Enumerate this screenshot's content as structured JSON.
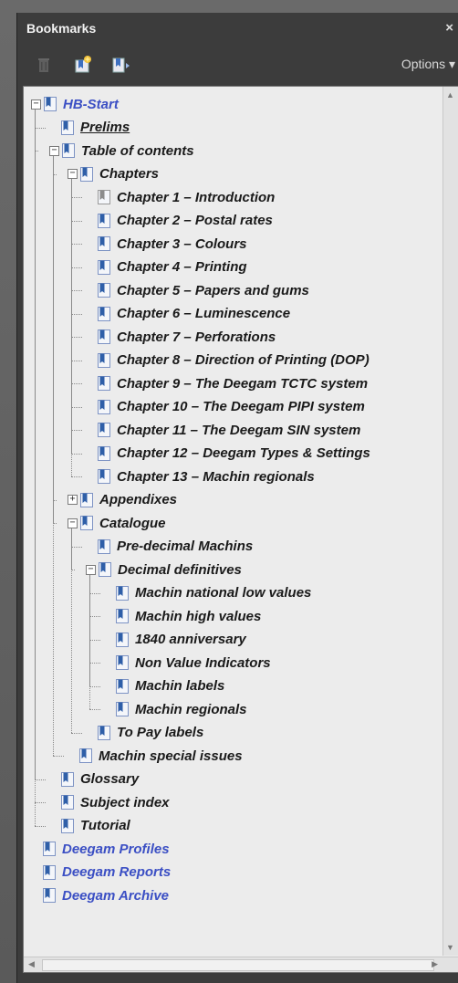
{
  "panel": {
    "title": "Bookmarks",
    "close_glyph": "×",
    "options_label": "Options",
    "options_arrow": "▾"
  },
  "toolbar": {
    "icons": [
      "trash-icon",
      "new-bookmark-icon",
      "expand-bookmark-icon"
    ]
  },
  "colors": {
    "link": "#3b4fc4",
    "text": "#1a1a1a",
    "icon_blue": "#2f5fa8"
  },
  "tree": [
    {
      "label": "HB-Start",
      "level": 0,
      "toggle": "minus",
      "link": true
    },
    {
      "label": "Prelims",
      "level": 1,
      "toggle": "none",
      "underline": true
    },
    {
      "label": "Table of contents",
      "level": 1,
      "toggle": "minus"
    },
    {
      "label": "Chapters",
      "level": 2,
      "toggle": "minus"
    },
    {
      "label": "Chapter 1 – Introduction",
      "level": 3,
      "toggle": "none",
      "grey_icon": true
    },
    {
      "label": "Chapter 2 – Postal rates",
      "level": 3,
      "toggle": "none"
    },
    {
      "label": "Chapter 3 – Colours",
      "level": 3,
      "toggle": "none"
    },
    {
      "label": "Chapter 4  – Printing",
      "level": 3,
      "toggle": "none"
    },
    {
      "label": "Chapter 5 – Papers and gums",
      "level": 3,
      "toggle": "none"
    },
    {
      "label": "Chapter 6 – Luminescence",
      "level": 3,
      "toggle": "none"
    },
    {
      "label": "Chapter 7 – Perforations",
      "level": 3,
      "toggle": "none"
    },
    {
      "label": "Chapter 8 – Direction of Printing (DOP)",
      "level": 3,
      "toggle": "none"
    },
    {
      "label": "Chapter 9 – The Deegam TCTC system",
      "level": 3,
      "toggle": "none"
    },
    {
      "label": "Chapter 10 – The Deegam PIPI system",
      "level": 3,
      "toggle": "none"
    },
    {
      "label": "Chapter 11 – The Deegam SIN system",
      "level": 3,
      "toggle": "none"
    },
    {
      "label": "Chapter 12 – Deegam Types & Settings",
      "level": 3,
      "toggle": "none"
    },
    {
      "label": "Chapter 13 – Machin regionals",
      "level": 3,
      "toggle": "none"
    },
    {
      "label": "Appendixes",
      "level": 2,
      "toggle": "plus"
    },
    {
      "label": "Catalogue",
      "level": 2,
      "toggle": "minus"
    },
    {
      "label": "Pre-decimal Machins",
      "level": 3,
      "toggle": "none"
    },
    {
      "label": "Decimal definitives",
      "level": 3,
      "toggle": "minus"
    },
    {
      "label": "Machin national low values",
      "level": 4,
      "toggle": "none"
    },
    {
      "label": "Machin high values",
      "level": 4,
      "toggle": "none"
    },
    {
      "label": "1840 anniversary",
      "level": 4,
      "toggle": "none"
    },
    {
      "label": "Non Value Indicators",
      "level": 4,
      "toggle": "none"
    },
    {
      "label": "Machin labels",
      "level": 4,
      "toggle": "none"
    },
    {
      "label": "Machin regionals",
      "level": 4,
      "toggle": "none"
    },
    {
      "label": "To Pay labels",
      "level": 3,
      "toggle": "none"
    },
    {
      "label": "Machin special issues",
      "level": 2,
      "toggle": "none"
    },
    {
      "label": "Glossary",
      "level": 1,
      "toggle": "none"
    },
    {
      "label": "Subject index",
      "level": 1,
      "toggle": "none"
    },
    {
      "label": "Tutorial",
      "level": 1,
      "toggle": "none"
    },
    {
      "label": "Deegam Profiles",
      "level": 0,
      "toggle": "none",
      "link": true
    },
    {
      "label": "Deegam Reports",
      "level": 0,
      "toggle": "none",
      "link": true
    },
    {
      "label": "Deegam Archive",
      "level": 0,
      "toggle": "none",
      "link": true
    }
  ]
}
